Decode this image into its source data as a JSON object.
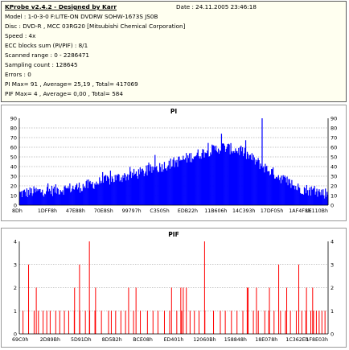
{
  "header": {
    "title": "KProbe v2.4.2 - Designed by Karr",
    "date": "Date : 24.11.2005 23:46:18",
    "lines": [
      "Model : 1-0-3-0 F:LITE-ON DVDRW SOHW-1673S JS0B",
      "Disc : DVD-R , MCC 03RG20  [Mitsubishi Chemical Corporation]",
      "Speed : 4x",
      "ECC blocks sum (PI/PIF) : 8/1",
      "Scanned range : 0 - 2286471",
      "Sampling count : 128645",
      "Errors : 0",
      "PI Max= 91 , Average= 25,19 , Total= 417069",
      "PIF Max= 4 , Average= 0,00 , Total= 584"
    ]
  },
  "chart_data": [
    {
      "type": "area",
      "title": "PI",
      "ylim": [
        0,
        90
      ],
      "yticks": [
        0,
        10,
        20,
        30,
        40,
        50,
        60,
        70,
        80,
        90
      ],
      "xlabels": [
        "8Dh",
        "1DFF8h",
        "47E88h",
        "70E8Sh",
        "99797h",
        "C3505h",
        "EDB22h",
        "11B606h",
        "14C393h",
        "17DF05h",
        "1AF4F8h",
        "1E110Bh"
      ],
      "color": "#0000ff",
      "grid": true,
      "profile_x": [
        0,
        0.05,
        0.1,
        0.2,
        0.3,
        0.4,
        0.5,
        0.6,
        0.66,
        0.72,
        0.8,
        0.9,
        1.0
      ],
      "profile_y": [
        12,
        14,
        15,
        19,
        27,
        34,
        44,
        55,
        60,
        56,
        38,
        18,
        12
      ],
      "noise": 6,
      "spikes": [
        {
          "x": 0.786,
          "y": 91
        },
        {
          "x": 0.655,
          "y": 74
        },
        {
          "x": 0.44,
          "y": 52
        }
      ],
      "n_bars": 395
    },
    {
      "type": "bar",
      "title": "PIF",
      "ylim": [
        0,
        4
      ],
      "yticks": [
        0,
        1,
        2,
        3,
        4
      ],
      "xlabels": [
        "69C0h",
        "2D89Bh",
        "5D91Dh",
        "8D5B2h",
        "BCE08h",
        "ED401h",
        "12060Bh",
        "158848h",
        "18E078h",
        "1C362Eh",
        "1F8E03h"
      ],
      "color": "#ff0000",
      "grid": true,
      "bars_value_1": [
        0.012,
        0.03,
        0.048,
        0.062,
        0.077,
        0.089,
        0.1,
        0.118,
        0.131,
        0.146,
        0.16,
        0.178,
        0.196,
        0.214,
        0.228,
        0.245,
        0.266,
        0.289,
        0.298,
        0.312,
        0.329,
        0.344,
        0.37,
        0.392,
        0.415,
        0.433,
        0.449,
        0.47,
        0.487,
        0.51,
        0.526,
        0.553,
        0.567,
        0.582,
        0.601,
        0.629,
        0.651,
        0.667,
        0.687,
        0.705,
        0.724,
        0.74,
        0.758,
        0.774,
        0.795,
        0.808,
        0.825,
        0.846,
        0.862,
        0.878,
        0.897,
        0.915,
        0.928,
        0.944,
        0.953,
        0.962,
        0.971,
        0.98,
        0.99
      ],
      "bars_value_2": [
        0.055,
        0.179,
        0.247,
        0.354,
        0.378,
        0.493,
        0.523,
        0.531,
        0.541,
        0.738,
        0.741,
        0.768,
        0.81,
        0.866,
        0.905,
        0.93,
        0.95
      ],
      "bars_value_3": [
        0.03,
        0.195,
        0.84,
        0.905
      ],
      "bars_value_4": [
        0.227,
        0.6
      ]
    }
  ]
}
